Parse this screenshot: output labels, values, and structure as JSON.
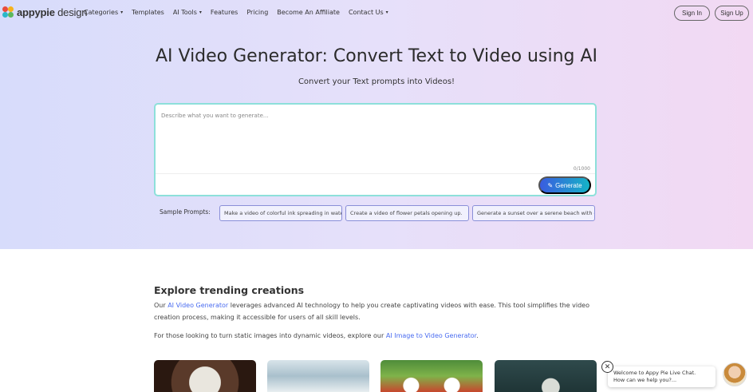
{
  "brand": {
    "logo_bold": "appypie",
    "logo_sub": " design"
  },
  "nav": {
    "items": [
      {
        "label": "Categories",
        "dropdown": true
      },
      {
        "label": "Templates",
        "dropdown": false
      },
      {
        "label": "AI Tools",
        "dropdown": true
      },
      {
        "label": "Features",
        "dropdown": false
      },
      {
        "label": "Pricing",
        "dropdown": false
      },
      {
        "label": "Become An Affiliate",
        "dropdown": false
      },
      {
        "label": "Contact Us",
        "dropdown": true
      }
    ],
    "caret": "▾",
    "signin": "Sign In",
    "signup": "Sign Up"
  },
  "hero": {
    "title": "AI Video Generator: Convert Text to Video using AI",
    "subtitle": "Convert your Text prompts into Videos!"
  },
  "prompt": {
    "placeholder": "Describe what you want to generate...",
    "counter": "0/1000",
    "generate_label": "Generate",
    "generate_icon": "✎"
  },
  "samples": {
    "label": "Sample Prompts:",
    "chips": [
      "Make a video of colorful ink spreading in water.",
      "Create a video of flower petals opening up.",
      "Generate a sunset over a serene beach with g..."
    ]
  },
  "explore": {
    "heading": "Explore trending creations",
    "para1_pre": "Our ",
    "para1_link": "AI Video Generator",
    "para1_post": " leverages advanced AI technology to help you create captivating videos with ease. This tool simplifies the video creation process, making it accessible for users of all skill levels.",
    "para2_pre": "For those looking to turn static images into dynamic videos, explore our ",
    "para2_link": "AI Image to Video Generator",
    "para2_post": "."
  },
  "chat": {
    "close": "✕",
    "line1": "Welcome to Appy Pie Live Chat.",
    "line2": "How can we help you?..."
  },
  "colors": {
    "accent_gradient_start": "#3a5ce0",
    "accent_gradient_end": "#15b3c6",
    "link": "#4a6cf0",
    "prompt_border": "#8de0da"
  }
}
